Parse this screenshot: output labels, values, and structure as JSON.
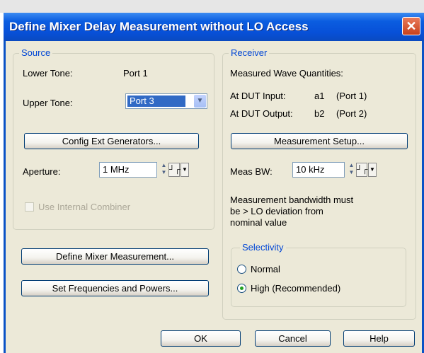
{
  "dialog": {
    "title": "Define Mixer Delay Measurement without LO Access",
    "close_glyph": "✕"
  },
  "source": {
    "legend": "Source",
    "lower_tone_label": "Lower Tone:",
    "lower_tone_value": "Port 1",
    "upper_tone_label": "Upper Tone:",
    "upper_tone_value": "Port 3",
    "config_button": "Config Ext Generators...",
    "aperture_label": "Aperture:",
    "aperture_value": "1 MHz",
    "combiner_label": "Use Internal Combiner",
    "combiner_checked": false
  },
  "receiver": {
    "legend": "Receiver",
    "measured_label": "Measured Wave Quantities:",
    "input_label": "At DUT Input:",
    "input_wave": "a1",
    "input_port": "(Port 1)",
    "output_label": "At DUT Output:",
    "output_wave": "b2",
    "output_port": "(Port 2)",
    "setup_button": "Measurement Setup...",
    "bw_label": "Meas BW:",
    "bw_value": "10 kHz",
    "note_line1": "Measurement bandwidth must",
    "note_line2": "be > LO deviation from",
    "note_line3": "nominal value"
  },
  "selectivity": {
    "legend": "Selectivity",
    "option_normal": "Normal",
    "option_high": "High (Recommended)",
    "selected": "High (Recommended)"
  },
  "actions": {
    "define_mixer": "Define Mixer Measurement...",
    "set_freq": "Set Frequencies and Powers...",
    "ok": "OK",
    "cancel": "Cancel",
    "help": "Help"
  },
  "icons": {
    "spin": "spin-arrows-icon",
    "step": "step-icon",
    "menu": "menu-arrow-icon",
    "dropdown": "chevron-down-icon"
  }
}
